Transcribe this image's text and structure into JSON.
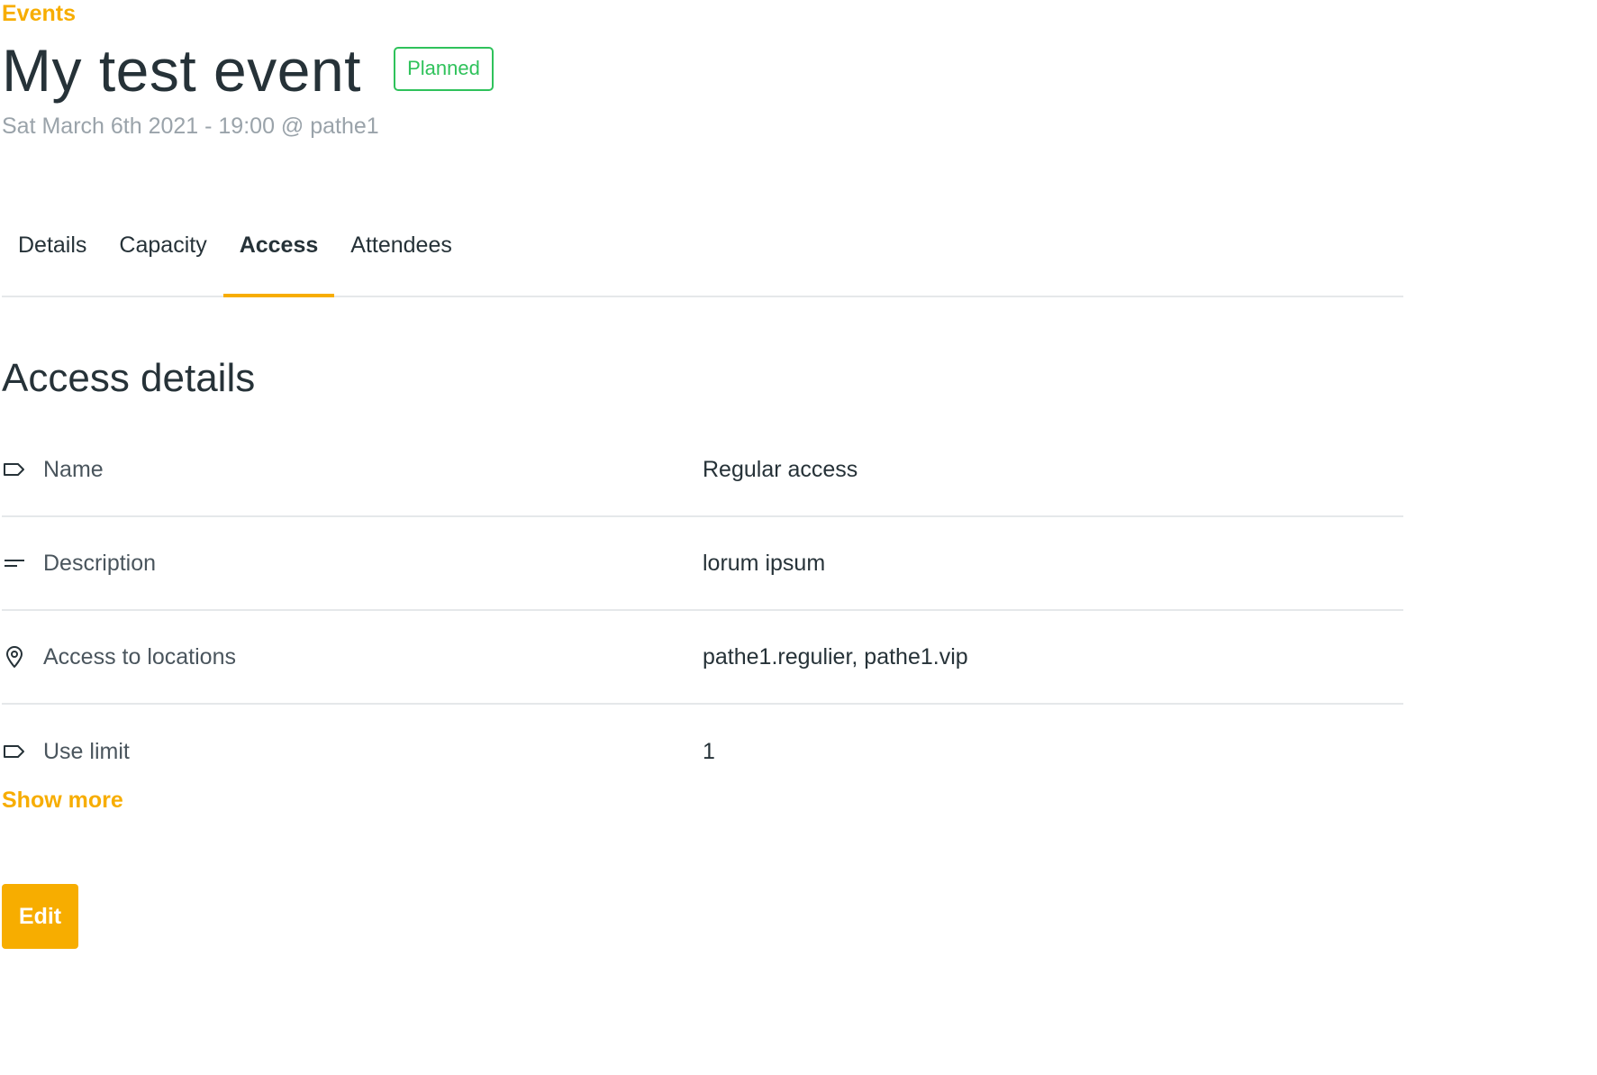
{
  "breadcrumb": {
    "label": "Events"
  },
  "event": {
    "title": "My test event",
    "status": "Planned",
    "subtitle": "Sat March 6th 2021 - 19:00 @ pathe1"
  },
  "tabs": [
    {
      "label": "Details",
      "active": false
    },
    {
      "label": "Capacity",
      "active": false
    },
    {
      "label": "Access",
      "active": true
    },
    {
      "label": "Attendees",
      "active": false
    }
  ],
  "section": {
    "title": "Access details"
  },
  "details": [
    {
      "label": "Name",
      "value": "Regular access",
      "icon": "tag-icon"
    },
    {
      "label": "Description",
      "value": "lorum ipsum",
      "icon": "text-lines-icon"
    },
    {
      "label": "Access to locations",
      "value": "pathe1.regulier, pathe1.vip",
      "icon": "location-pin-icon"
    },
    {
      "label": "Use limit",
      "value": "1",
      "icon": "tag-icon"
    }
  ],
  "actions": {
    "show_more_label": "Show more",
    "edit_label": "Edit"
  },
  "colors": {
    "accent": "#f7ad00",
    "status_green": "#2fc25b",
    "text_dark": "#263238",
    "text_muted": "#9aa3aa",
    "divider": "#e5e8ea"
  }
}
